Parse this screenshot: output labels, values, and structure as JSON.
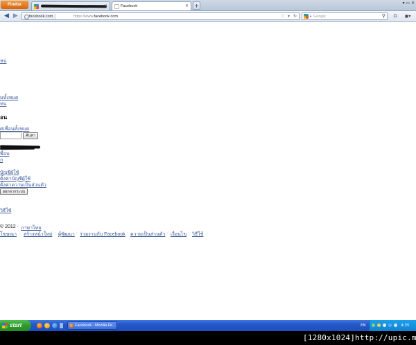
{
  "browser": {
    "firefox_button": "Firefox",
    "tabs": [
      {
        "label": "",
        "active": false
      },
      {
        "label": "Facebook",
        "active": true
      }
    ],
    "new_tab": "+",
    "url": {
      "site_identity": "facebook.com",
      "prefix": "https://www.",
      "domain": "facebook.com"
    },
    "search_placeholder": "Google",
    "window_controls": "▾ ▭ ✕"
  },
  "page": {
    "link_top": "หน่",
    "link_all": "มทั้งหมด",
    "link_short": "ทน",
    "heading": "อน",
    "link_all_friends": "ศเพื่อนทั้งหมด",
    "search_button": "ค้นหา",
    "link_friend": "พื่อน",
    "link_n": "ก",
    "link_account1": "บัญชีผู้ใช้",
    "link_account2": "ตั้งค่าบัญชีผู้ใช้",
    "link_privacy": "ตั้งค่าความเป็นส่วนตัว",
    "logout_button": "ออกจากระบบ",
    "link_help": "วิธีใช้",
    "copyright": "© 2012 ·",
    "language_link": "ภาษาไทย",
    "footer_links": [
      "โฆษณา",
      "สร้างหน้าใหม่",
      "ผู้พัฒนา",
      "ร่วมงานกับ Facebook",
      "ความเป็นส่วนตัว",
      "เงื่อนไข",
      "วิธีใช้"
    ],
    "footer_sep": "·"
  },
  "taskbar": {
    "start_label": "start",
    "task_item": "Facebook - Mozilla Fir...",
    "language": "EN",
    "clock": "4:35"
  },
  "watermark": "[1280x1024]http://upic.me/"
}
